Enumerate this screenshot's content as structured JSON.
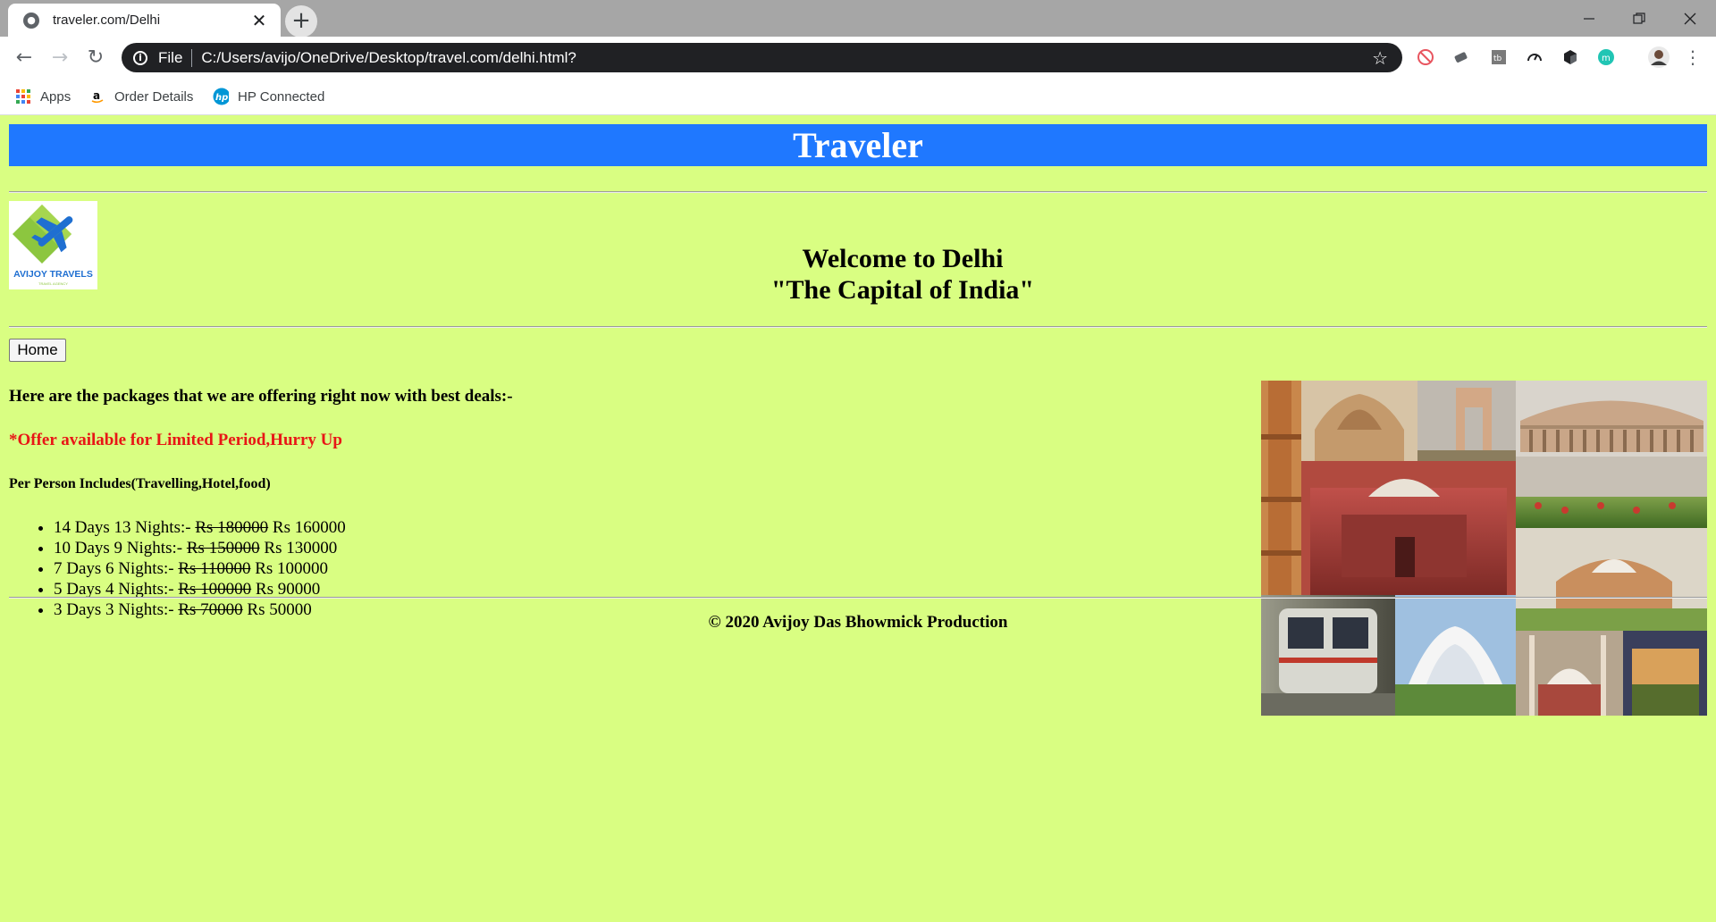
{
  "browser": {
    "tab_title": "traveler.com/Delhi",
    "url_scheme": "File",
    "url": "C:/Users/avijo/OneDrive/Desktop/travel.com/delhi.html?",
    "bookmarks": [
      {
        "label": "Apps",
        "icon": "apps-grid-icon"
      },
      {
        "label": "Order Details",
        "icon": "amazon-icon"
      },
      {
        "label": "HP Connected",
        "icon": "hp-icon"
      }
    ]
  },
  "page": {
    "banner": "Traveler",
    "logo_text": "AVIJOY TRAVELS",
    "logo_subtext": "TRAVEL AGENCY",
    "welcome_line1": "Welcome to Delhi",
    "welcome_line2": "\"The Capital of India\"",
    "home_button": "Home",
    "intro": "Here are the packages that we are offering right now with best deals:-",
    "offer": "*Offer available for Limited Period,Hurry Up",
    "includes": "Per Person Includes(Travelling,Hotel,food)",
    "packages": [
      {
        "duration": "14 Days 13 Nights:-",
        "old_price": "Rs 180000",
        "new_price": "Rs 160000"
      },
      {
        "duration": "10 Days 9 Nights:-",
        "old_price": "Rs 150000",
        "new_price": "Rs 130000"
      },
      {
        "duration": "7 Days 6 Nights:-",
        "old_price": "Rs 110000",
        "new_price": "Rs 100000"
      },
      {
        "duration": "5 Days 4 Nights:-",
        "old_price": "Rs 100000",
        "new_price": "Rs 90000"
      },
      {
        "duration": "3 Days 3 Nights:-",
        "old_price": "Rs 70000",
        "new_price": "Rs 50000"
      }
    ],
    "footer": "© 2020 Avijoy Das Bhowmick Production"
  },
  "colors": {
    "page_background": "#d9fe82",
    "banner_background": "#1f78ff",
    "offer_text": "#e81616"
  }
}
